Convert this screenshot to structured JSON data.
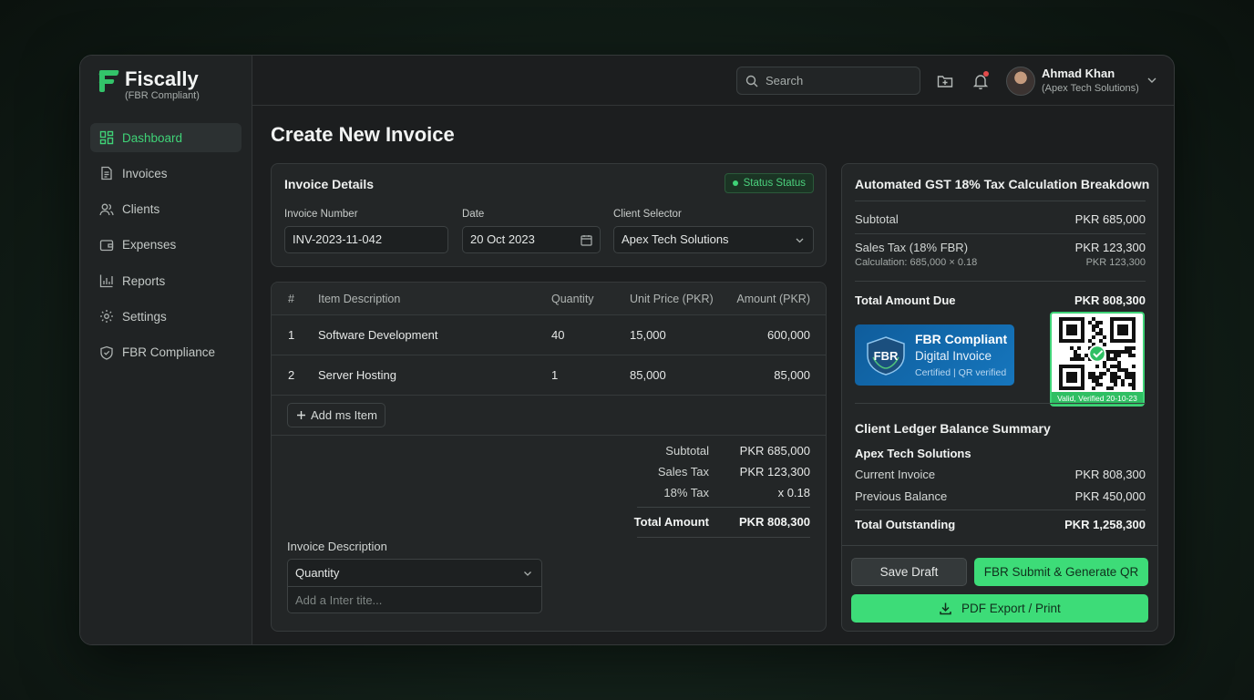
{
  "brand": {
    "name": "Fiscally",
    "subtitle": "(FBR Compliant)"
  },
  "sidebar": {
    "items": [
      {
        "label": "Dashboard",
        "icon": "dashboard-icon",
        "active": true
      },
      {
        "label": "Invoices",
        "icon": "invoice-icon"
      },
      {
        "label": "Clients",
        "icon": "users-icon"
      },
      {
        "label": "Expenses",
        "icon": "wallet-icon"
      },
      {
        "label": "Reports",
        "icon": "bar-chart-icon"
      },
      {
        "label": "Settings",
        "icon": "gear-icon"
      },
      {
        "label": "FBR Compliance",
        "icon": "shield-icon"
      }
    ]
  },
  "topbar": {
    "search_placeholder": "Search",
    "user": {
      "name": "Ahmad Khan",
      "company": "(Apex Tech Solutions)"
    }
  },
  "page": {
    "title": "Create New Invoice"
  },
  "details": {
    "title": "Invoice Details",
    "status": "Status Status",
    "invoice_number_label": "Invoice Number",
    "invoice_number": "INV-2023-11-042",
    "date_label": "Date",
    "date": "20 Oct 2023",
    "client_label": "Client Selector",
    "client": "Apex Tech Solutions"
  },
  "items": {
    "headers": [
      "#",
      "Item Description",
      "Quantity",
      "Unit Price (PKR)",
      "Amount (PKR)"
    ],
    "rows": [
      {
        "n": "1",
        "desc": "Software Development",
        "qty": "40",
        "price": "15,000",
        "amount": "600,000"
      },
      {
        "n": "2",
        "desc": "Server Hosting",
        "qty": "1",
        "price": "85,000",
        "amount": "85,000"
      }
    ],
    "add_label": "Add ms Item",
    "totals": {
      "subtotal_label": "Subtotal",
      "subtotal": "PKR 685,000",
      "tax_label": "Sales Tax",
      "tax": "PKR 123,300",
      "rate_label": "18% Tax",
      "rate": "x 0.18",
      "total_label": "Total Amount",
      "total": "PKR 808,300"
    },
    "description_label": "Invoice Description",
    "description_select": "Quantity",
    "description_placeholder": "Add a Inter tite..."
  },
  "gst": {
    "title": "Automated GST 18% Tax Calculation Breakdown",
    "subtotal_label": "Subtotal",
    "subtotal": "PKR 685,000",
    "tax_label": "Sales Tax (18% FBR)",
    "tax": "PKR 123,300",
    "calc_label": "Calculation: 685,000 × 0.18",
    "calc": "PKR 123,300",
    "total_label": "Total Amount Due",
    "total": "PKR 808,300",
    "badge": {
      "line1": "FBR Compliant",
      "line2": "Digital Invoice",
      "line3": "Certified | QR verified",
      "seal": "FBR"
    },
    "qr_caption": "Valid, Verified 20-10-23",
    "ledger": {
      "title": "Client Ledger Balance Summary",
      "client": "Apex Tech Solutions",
      "current_label": "Current Invoice",
      "current": "PKR 808,300",
      "previous_label": "Previous Balance",
      "previous": "PKR 450,000",
      "outstanding_label": "Total Outstanding",
      "outstanding": "PKR 1,258,300"
    },
    "buttons": {
      "draft": "Save Draft",
      "submit": "FBR Submit & Generate QR",
      "pdf": "PDF Export / Print"
    }
  },
  "colors": {
    "accent": "#3ddc78",
    "background": "#1c1e1f",
    "badge_blue": "#1676bd"
  }
}
